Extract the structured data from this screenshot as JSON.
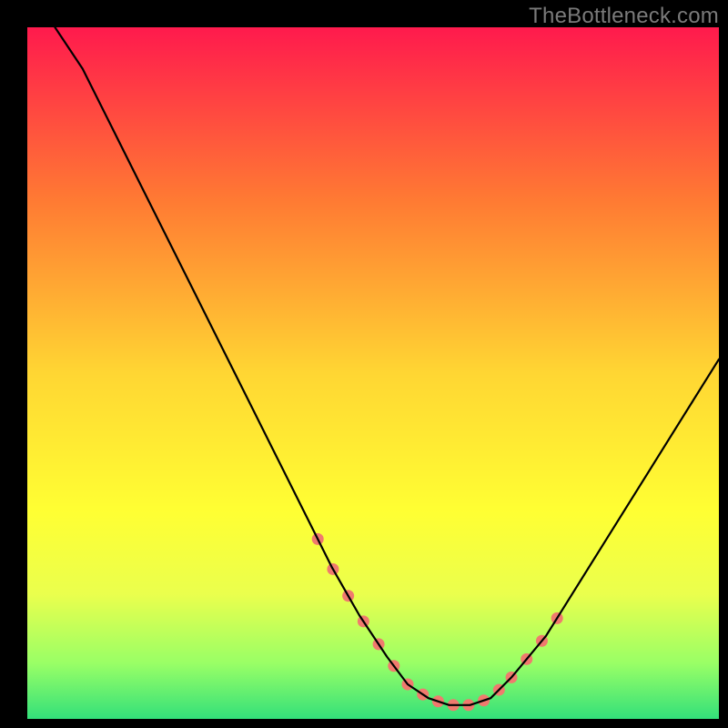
{
  "watermark": "TheBottleneck.com",
  "chart_data": {
    "type": "line",
    "title": "",
    "xlabel": "",
    "ylabel": "",
    "xlim": [
      0,
      100
    ],
    "ylim": [
      0,
      100
    ],
    "x": [
      4,
      8,
      12,
      16,
      20,
      24,
      28,
      32,
      36,
      40,
      44,
      48,
      52,
      55,
      58,
      61,
      64,
      67,
      70,
      75,
      80,
      85,
      90,
      95,
      100
    ],
    "values": [
      100,
      94,
      86,
      78,
      70,
      62,
      54,
      46,
      38,
      30,
      22,
      15,
      9,
      5,
      3,
      2,
      2,
      3,
      6,
      12,
      20,
      28,
      36,
      44,
      52
    ],
    "highlight_ranges": [
      {
        "x_start": 42,
        "x_end": 55,
        "color": "#f07a6e"
      },
      {
        "x_start": 55,
        "x_end": 70,
        "color": "#f07a6e"
      },
      {
        "x_start": 70,
        "x_end": 77,
        "color": "#f07a6e"
      }
    ],
    "gradient_stops": [
      {
        "offset": 0.0,
        "color": "#ff1a4d"
      },
      {
        "offset": 0.25,
        "color": "#ff7a33"
      },
      {
        "offset": 0.5,
        "color": "#ffd633"
      },
      {
        "offset": 0.7,
        "color": "#ffff33"
      },
      {
        "offset": 0.82,
        "color": "#eaff4d"
      },
      {
        "offset": 0.92,
        "color": "#99ff66"
      },
      {
        "offset": 1.0,
        "color": "#33e07a"
      }
    ],
    "inner_frame_color": "#000000"
  }
}
